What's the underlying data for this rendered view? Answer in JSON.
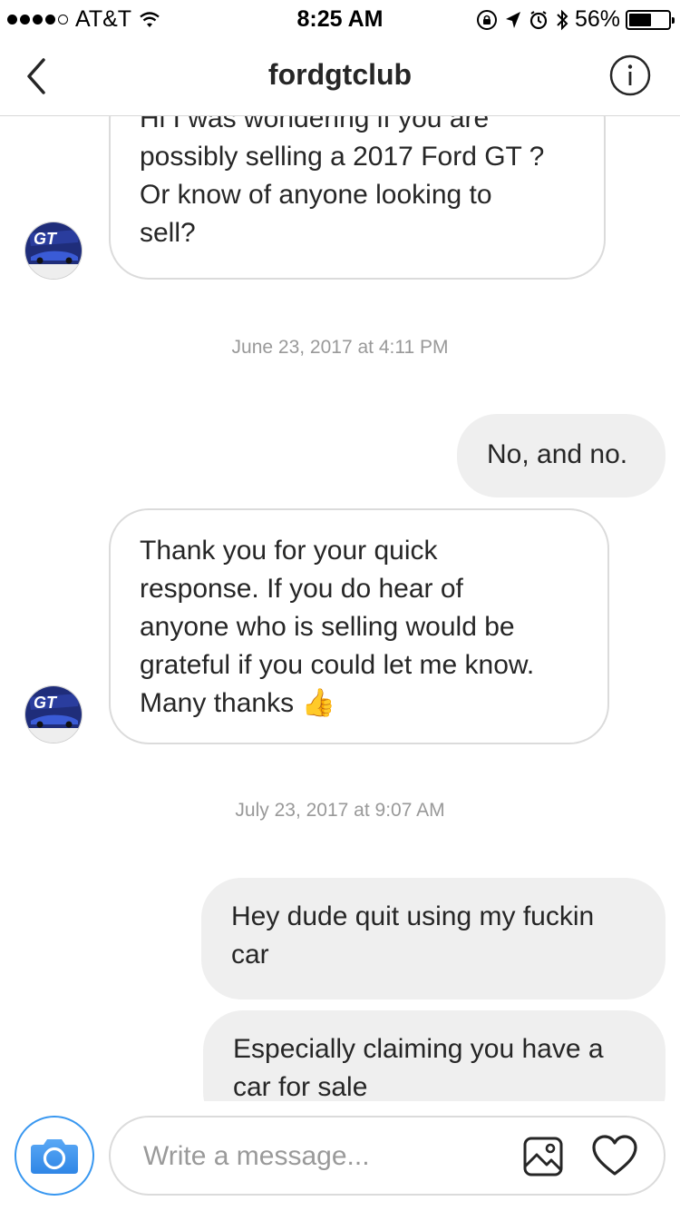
{
  "status_bar": {
    "carrier": "AT&T",
    "time": "8:25 AM",
    "battery_percent": "56%",
    "battery_level": 0.56,
    "signal_bars_filled": 4,
    "signal_bars_total": 5
  },
  "header": {
    "title": "fordgtclub",
    "back_icon": "chevron-left-icon",
    "info_icon": "info-circle-icon"
  },
  "messages": [
    {
      "side": "incoming",
      "lines": [
        "Hi I was wondering if you are",
        "possibly selling a 2017 Ford GT ?",
        "Or know of anyone looking to",
        "sell?"
      ]
    },
    {
      "type": "timestamp",
      "text": "June 23, 2017 at 4:11 PM"
    },
    {
      "side": "outgoing",
      "lines": [
        "No, and no."
      ]
    },
    {
      "side": "incoming",
      "lines": [
        "Thank you for your quick",
        "response. If you do hear of",
        "anyone who is selling would be",
        "grateful if you could let me know.",
        "Many thanks"
      ],
      "emoji": "👍"
    },
    {
      "type": "timestamp",
      "text": "July 23, 2017 at 9:07 AM"
    },
    {
      "side": "outgoing",
      "lines": [
        "Hey dude quit using my fuckin",
        "car"
      ]
    },
    {
      "side": "outgoing",
      "lines": [
        "Especially claiming you have a",
        "car for sale"
      ]
    }
  ],
  "composer": {
    "placeholder": "Write a message...",
    "camera_icon": "camera-icon",
    "gallery_icon": "image-icon",
    "like_icon": "heart-icon"
  },
  "colors": {
    "accent_blue": "#3897f0",
    "outgoing_bubble": "#efefef",
    "incoming_border": "#dbdbdb",
    "timestamp_text": "#999999"
  }
}
